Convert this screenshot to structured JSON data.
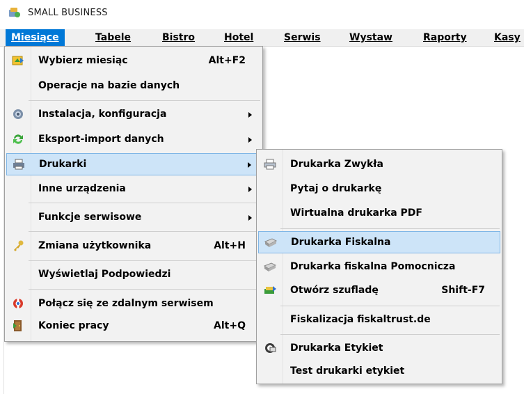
{
  "window": {
    "title": "SMALL BUSINESS"
  },
  "menubar": [
    {
      "label": "Miesiące",
      "active": true
    },
    {
      "label": "Tabele"
    },
    {
      "label": "Bistro"
    },
    {
      "label": "Hotel"
    },
    {
      "label": "Serwis"
    },
    {
      "label": "Wystaw"
    },
    {
      "label": "Raporty"
    },
    {
      "label": "Kasy"
    }
  ],
  "main_menu": {
    "items": [
      {
        "label": "Wybierz miesiąc",
        "shortcut": "Alt+F2",
        "icon": "calendar-icon"
      },
      {
        "label": "Operacje na bazie danych"
      },
      {
        "label": "Instalacja, konfiguracja",
        "icon": "gear-icon",
        "submenu": true
      },
      {
        "label": "Eksport-import danych",
        "icon": "refresh-icon",
        "submenu": true
      },
      {
        "label": "Drukarki",
        "icon": "printer-icon",
        "submenu": true,
        "highlighted": true
      },
      {
        "label": "Inne urządzenia",
        "submenu": true
      },
      {
        "label": "Funkcje serwisowe",
        "submenu": true
      },
      {
        "label": "Zmiana użytkownika",
        "shortcut": "Alt+H",
        "icon": "key-icon"
      },
      {
        "label": "Wyświetlaj Podpowiedzi"
      },
      {
        "label": "Połącz się ze zdalnym serwisem",
        "icon": "support-icon"
      },
      {
        "label": "Koniec pracy",
        "shortcut": "Alt+Q",
        "icon": "exit-door-icon"
      }
    ]
  },
  "sub_menu": {
    "items": [
      {
        "label": "Drukarka Zwykła",
        "icon": "printer-icon"
      },
      {
        "label": "Pytaj o drukarkę"
      },
      {
        "label": "Wirtualna drukarka PDF"
      },
      {
        "label": "Drukarka Fiskalna",
        "icon": "fiscal-printer-icon",
        "highlighted": true
      },
      {
        "label": "Drukarka fiskalna Pomocnicza",
        "icon": "fiscal-printer-icon"
      },
      {
        "label": "Otwórz szufladę",
        "shortcut": "Shift-F7",
        "icon": "cash-drawer-icon"
      },
      {
        "label": "Fiskalizacja fiskaltrust.de"
      },
      {
        "label": "Drukarka Etykiet",
        "icon": "label-printer-icon"
      },
      {
        "label": "Test drukarki etykiet"
      }
    ]
  },
  "colors": {
    "menubar_active": "#0078d7",
    "highlight_bg": "#cde4f8",
    "highlight_border": "#7fb6e6",
    "menu_bg": "#f2f2f2"
  }
}
